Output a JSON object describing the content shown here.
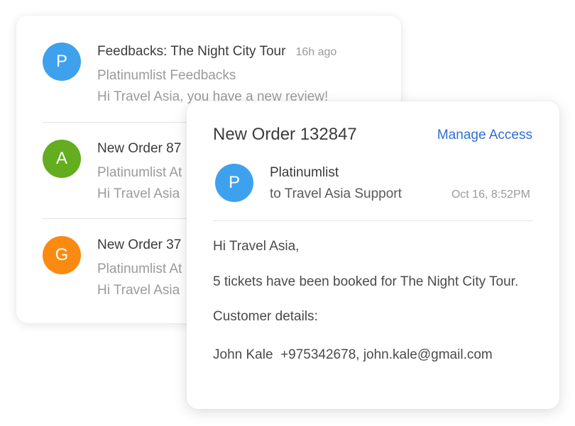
{
  "inbox": {
    "items": [
      {
        "avatar_letter": "P",
        "avatar_color": "#3ea1ee",
        "title": "Feedbacks: The Night City Tour",
        "time": "16h ago",
        "sender": "Platinumlist Feedbacks",
        "preview": "Hi Travel Asia, you have a new review!"
      },
      {
        "avatar_letter": "A",
        "avatar_color": "#64ad1e",
        "title": "New Order 87",
        "sender": "Platinumlist At",
        "preview": "Hi Travel Asia"
      },
      {
        "avatar_letter": "G",
        "avatar_color": "#fb8a12",
        "title": "New Order 37",
        "sender": "Platinumlist At",
        "preview": "Hi Travel Asia"
      }
    ]
  },
  "detail": {
    "title": "New Order 132847",
    "manage_access_label": "Manage Access",
    "manage_access_color": "#2f6fd1",
    "avatar_letter": "P",
    "avatar_color": "#3ea1ee",
    "sender_name": "Platinumlist",
    "recipient": "to Travel Asia Support",
    "sent_time": "Oct 16, 8:52PM",
    "body": {
      "greeting": "Hi Travel Asia,",
      "booked": "5 tickets have been booked for The Night City Tour.",
      "customer_label": "Customer details:",
      "customer_line": "John Kale  +975342678, john.kale@gmail.com"
    }
  }
}
